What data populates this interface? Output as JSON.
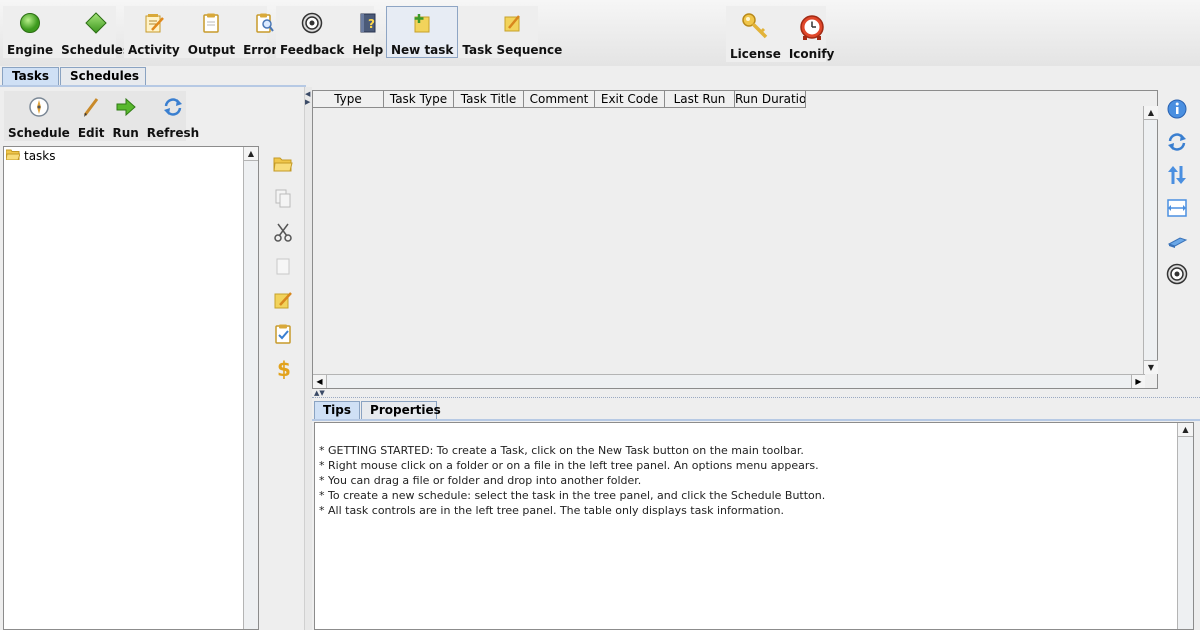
{
  "toolbar": {
    "groups": [
      [
        {
          "label": "Engine",
          "icon": "green-circle-icon"
        },
        {
          "label": "Schedules",
          "icon": "green-diamond-icon"
        }
      ],
      [
        {
          "label": "Activity",
          "icon": "notepad-pencil-icon"
        },
        {
          "label": "Output",
          "icon": "clipboard-icon"
        },
        {
          "label": "Errors",
          "icon": "clipboard-search-icon"
        }
      ],
      [
        {
          "label": "Feedback",
          "icon": "target-icon"
        },
        {
          "label": "Help",
          "icon": "help-book-icon"
        }
      ],
      [
        {
          "label": "New task",
          "icon": "new-task-icon"
        },
        {
          "label": "Task Sequence",
          "icon": "task-sequence-icon"
        }
      ],
      [
        {
          "label": "License",
          "icon": "key-icon"
        },
        {
          "label": "Iconify",
          "icon": "alarm-clock-icon"
        }
      ]
    ]
  },
  "main_tabs": [
    "Tasks",
    "Schedules"
  ],
  "task_toolbar": [
    {
      "label": "Schedule",
      "icon": "compass-icon"
    },
    {
      "label": "Edit",
      "icon": "pencil-icon"
    },
    {
      "label": "Run",
      "icon": "green-arrow-icon"
    },
    {
      "label": "Refresh",
      "icon": "refresh-icon"
    }
  ],
  "tree": {
    "root": "tasks"
  },
  "table": {
    "columns": [
      "Type",
      "Task Type",
      "Task Title",
      "Comment",
      "Exit Code",
      "Last Run",
      "Run Duration"
    ]
  },
  "bottom_tabs": [
    "Tips",
    "Properties"
  ],
  "tips": [
    "*  GETTING STARTED: To create a Task, click on the New Task button on the main toolbar.",
    "*  Right mouse click on a folder or on a file in the left tree panel.  An options menu appears.",
    "*  You can drag a file or folder and drop into another folder.",
    "*  To create a new schedule: select the task in the tree panel, and click the Schedule Button.",
    "*  All task controls are in the left tree panel.  The table only displays task information."
  ]
}
